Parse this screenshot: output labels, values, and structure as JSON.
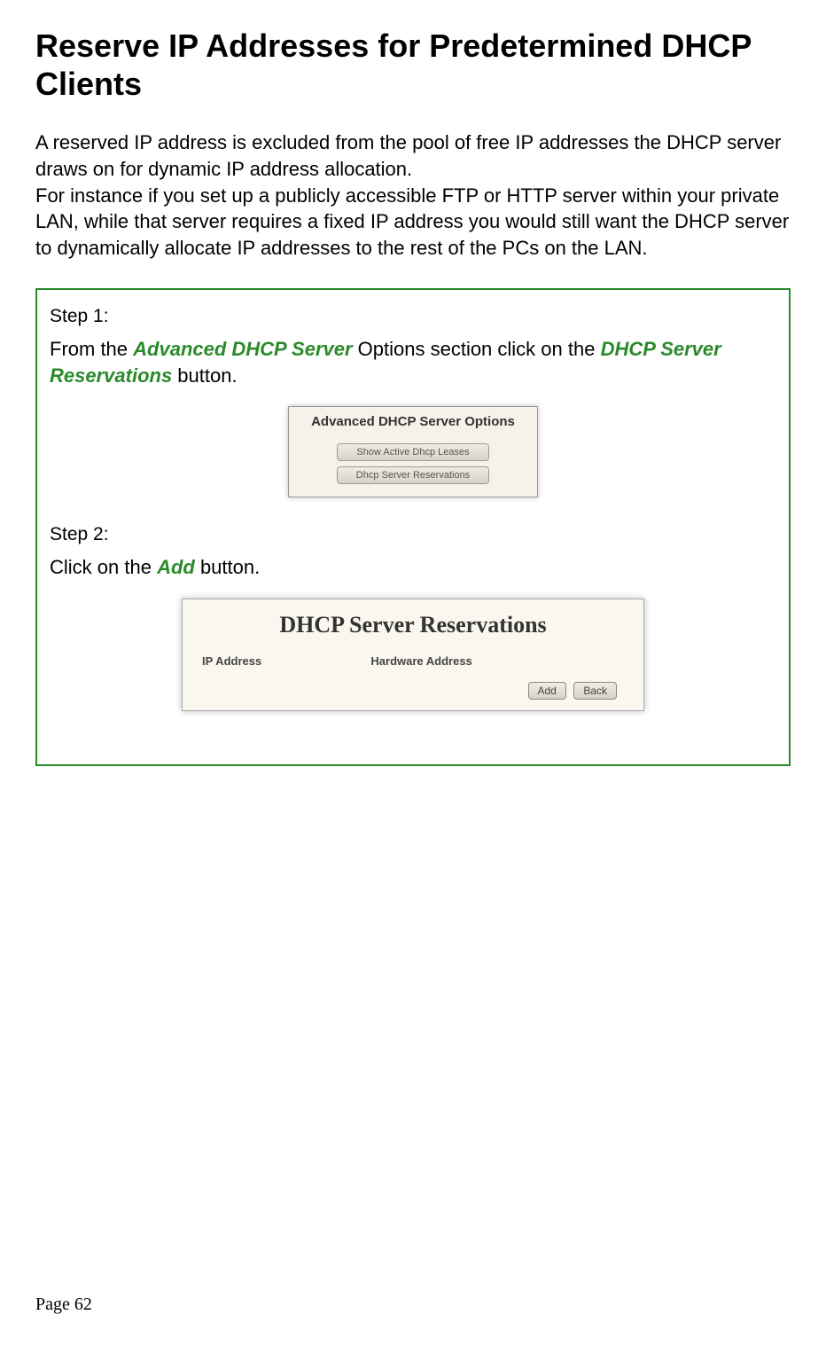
{
  "title": "Reserve IP Addresses for Predetermined DHCP Clients",
  "intro_a": "A reserved IP address is excluded from the pool of free IP addresses the DHCP server draws on for dynamic IP address allocation.",
  "intro_b": "For instance if you set up a publicly accessible FTP or HTTP server within your private LAN, while that server requires a fixed IP address you would still want the DHCP server to dynamically allocate IP addresses to the rest of the PCs on the LAN.",
  "step1": {
    "label": "Step 1:",
    "pre": "From the ",
    "hl1": "Advanced DHCP Server",
    "mid": " Options section click on the ",
    "hl2": "DHCP Server Reservations",
    "post": " button."
  },
  "img1": {
    "title": "Advanced DHCP Server Options",
    "btn1": "Show Active Dhcp Leases",
    "btn2": "Dhcp Server Reservations"
  },
  "step2": {
    "label": "Step 2:",
    "pre": "Click on the ",
    "hl": "Add",
    "post": " button."
  },
  "img2": {
    "title": "DHCP Server Reservations",
    "col1": "IP Address",
    "col2": "Hardware Address",
    "btn_add": "Add",
    "btn_back": "Back"
  },
  "page_num": "Page 62"
}
